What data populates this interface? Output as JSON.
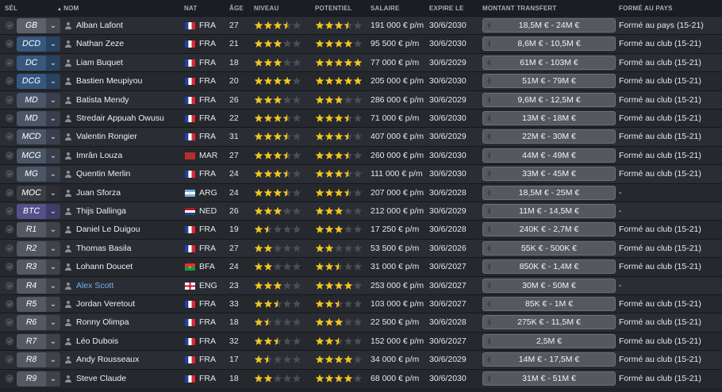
{
  "columns": {
    "sel": "SÉL",
    "nom": "NOM",
    "nat": "NAT",
    "age": "ÂGE",
    "niveau": "NIVEAU",
    "potentiel": "POTENTIEL",
    "salaire": "SALAIRE",
    "expire": "EXPIRE LE",
    "montant": "MONTANT TRANSFERT",
    "forme": "FORMÉ AU PAYS"
  },
  "position_colors": {
    "gk": "#5d6068",
    "def": "#36587f",
    "mid": "#4b5566",
    "att": "#54508a"
  },
  "star_colors": {
    "filled": "#f2c521",
    "empty": "#4a4e55",
    "potential_half": "#ffffff"
  },
  "players": [
    {
      "pos": "GB",
      "pos_class": "gk",
      "name": "Alban Lafont",
      "flag": "france",
      "nat": "FRA",
      "age": "27",
      "ability": 3.5,
      "potential": 3.5,
      "salary": "191 000 € p/m",
      "expires": "30/6/2030",
      "value": "18,5M € - 24M €",
      "homegrown": "Formé au pays (15-21)"
    },
    {
      "pos": "DCD",
      "pos_class": "def",
      "name": "Nathan Zeze",
      "flag": "france",
      "nat": "FRA",
      "age": "21",
      "ability": 3.0,
      "potential": 4.0,
      "potential_half": true,
      "salary": "95 500 € p/m",
      "expires": "30/6/2030",
      "value": "8,6M € - 10,5M €",
      "homegrown": "Formé au club (15-21)"
    },
    {
      "pos": "DC",
      "pos_class": "def",
      "name": "Liam Buquet",
      "flag": "france",
      "nat": "FRA",
      "age": "18",
      "ability": 3.0,
      "potential": 5.0,
      "potential_half": true,
      "salary": "77 000 € p/m",
      "expires": "30/6/2029",
      "value": "61M € - 103M €",
      "homegrown": "Formé au club (15-21)"
    },
    {
      "pos": "DCG",
      "pos_class": "def",
      "name": "Bastien Meupiyou",
      "flag": "france",
      "nat": "FRA",
      "age": "20",
      "ability": 4.0,
      "potential": 5.0,
      "potential_half": true,
      "salary": "205 000 € p/m",
      "expires": "30/6/2030",
      "value": "51M € - 79M €",
      "homegrown": "Formé au club (15-21)"
    },
    {
      "pos": "MD",
      "pos_class": "mid",
      "name": "Batista Mendy",
      "flag": "france",
      "nat": "FRA",
      "age": "26",
      "ability": 3.0,
      "potential": 3.0,
      "salary": "286 000 € p/m",
      "expires": "30/6/2029",
      "value": "9,6M € - 12,5M €",
      "homegrown": "Formé au club (15-21)"
    },
    {
      "pos": "MD",
      "pos_class": "mid",
      "name": "Stredair Appuah Owusu",
      "flag": "france",
      "nat": "FRA",
      "age": "22",
      "ability": 3.5,
      "potential": 3.5,
      "salary": "71 000 € p/m",
      "expires": "30/6/2030",
      "value": "13M € - 18M €",
      "homegrown": "Formé au club (15-21)"
    },
    {
      "pos": "MCD",
      "pos_class": "mid",
      "name": "Valentin Rongier",
      "flag": "france",
      "nat": "FRA",
      "age": "31",
      "ability": 3.5,
      "potential": 3.5,
      "salary": "407 000 € p/m",
      "expires": "30/6/2029",
      "value": "22M € - 30M €",
      "homegrown": "Formé au club (15-21)"
    },
    {
      "pos": "MCG",
      "pos_class": "mid",
      "name": "Imrân Louza",
      "flag": "morocco",
      "nat": "MAR",
      "age": "27",
      "ability": 3.5,
      "potential": 3.5,
      "salary": "260 000 € p/m",
      "expires": "30/6/2030",
      "value": "44M € - 49M €",
      "homegrown": "Formé au club (15-21)"
    },
    {
      "pos": "MG",
      "pos_class": "mid",
      "name": "Quentin Merlin",
      "flag": "france",
      "nat": "FRA",
      "age": "24",
      "ability": 3.5,
      "potential": 3.5,
      "salary": "111 000 € p/m",
      "expires": "30/6/2030",
      "value": "33M € - 45M €",
      "homegrown": "Formé au club (15-21)"
    },
    {
      "pos": "MOC",
      "pos_class": "dark",
      "name": "Juan Sforza",
      "flag": "argentina",
      "nat": "ARG",
      "age": "24",
      "ability": 3.5,
      "potential": 3.5,
      "salary": "207 000 € p/m",
      "expires": "30/6/2028",
      "value": "18,5M € - 25M €",
      "homegrown": "-"
    },
    {
      "pos": "BTC",
      "pos_class": "att",
      "name": "Thijs Dallinga",
      "flag": "netherlands",
      "nat": "NED",
      "age": "26",
      "ability": 3.0,
      "potential": 3.0,
      "salary": "212 000 € p/m",
      "expires": "30/6/2029",
      "value": "11M € - 14,5M €",
      "homegrown": "-"
    },
    {
      "pos": "R1",
      "pos_class": "gen",
      "name": "Daniel Le Duigou",
      "flag": "france",
      "nat": "FRA",
      "age": "19",
      "ability": 1.5,
      "potential": 3.0,
      "potential_half": true,
      "salary": "17 250 € p/m",
      "expires": "30/6/2028",
      "value": "240K € - 2,7M €",
      "homegrown": "Formé au club (15-21)"
    },
    {
      "pos": "R2",
      "pos_class": "gen",
      "name": "Thomas Basila",
      "flag": "france",
      "nat": "FRA",
      "age": "27",
      "ability": 2.0,
      "potential": 2.0,
      "salary": "53 500 € p/m",
      "expires": "30/6/2026",
      "value": "55K € - 500K €",
      "homegrown": "Formé au club (15-21)"
    },
    {
      "pos": "R3",
      "pos_class": "gen",
      "name": "Lohann Doucet",
      "flag": "burkina",
      "nat": "BFA",
      "age": "24",
      "ability": 2.0,
      "potential": 2.5,
      "salary": "31 000 € p/m",
      "expires": "30/6/2027",
      "value": "850K € - 1,4M €",
      "homegrown": "Formé au club (15-21)"
    },
    {
      "pos": "R4",
      "pos_class": "gen",
      "name": "Alex Scott",
      "flag": "england",
      "nat": "ENG",
      "age": "23",
      "ability": 3.0,
      "potential": 4.0,
      "salary": "253 000 € p/m",
      "expires": "30/6/2027",
      "value": "30M € - 50M €",
      "homegrown": "-",
      "highlight": true
    },
    {
      "pos": "R5",
      "pos_class": "gen",
      "name": "Jordan Veretout",
      "flag": "france",
      "nat": "FRA",
      "age": "33",
      "ability": 2.5,
      "potential": 2.5,
      "salary": "103 000 € p/m",
      "expires": "30/6/2027",
      "value": "85K € - 1M €",
      "homegrown": "Formé au club (15-21)"
    },
    {
      "pos": "R6",
      "pos_class": "gen",
      "name": "Ronny Olimpa",
      "flag": "france",
      "nat": "FRA",
      "age": "18",
      "ability": 1.5,
      "potential": 3.0,
      "potential_half": true,
      "salary": "22 500 € p/m",
      "expires": "30/6/2028",
      "value": "275K € - 11,5M €",
      "homegrown": "Formé au club (15-21)"
    },
    {
      "pos": "R7",
      "pos_class": "gen",
      "name": "Léo Dubois",
      "flag": "france",
      "nat": "FRA",
      "age": "32",
      "ability": 2.5,
      "potential": 2.5,
      "salary": "152 000 € p/m",
      "expires": "30/6/2027",
      "value": "2,5M €",
      "homegrown": "Formé au club (15-21)"
    },
    {
      "pos": "R8",
      "pos_class": "gen",
      "name": "Andy Rousseaux",
      "flag": "france",
      "nat": "FRA",
      "age": "17",
      "ability": 1.5,
      "potential": 4.0,
      "potential_half": true,
      "salary": "34 000 € p/m",
      "expires": "30/6/2029",
      "value": "14M € - 17,5M €",
      "homegrown": "Formé au club (15-21)"
    },
    {
      "pos": "R9",
      "pos_class": "gen",
      "name": "Steve Claude",
      "flag": "france",
      "nat": "FRA",
      "age": "18",
      "ability": 2.0,
      "potential": 4.0,
      "potential_half": true,
      "salary": "68 000 € p/m",
      "expires": "30/6/2030",
      "value": "31M € - 51M €",
      "homegrown": "Formé au club (15-21)"
    }
  ]
}
